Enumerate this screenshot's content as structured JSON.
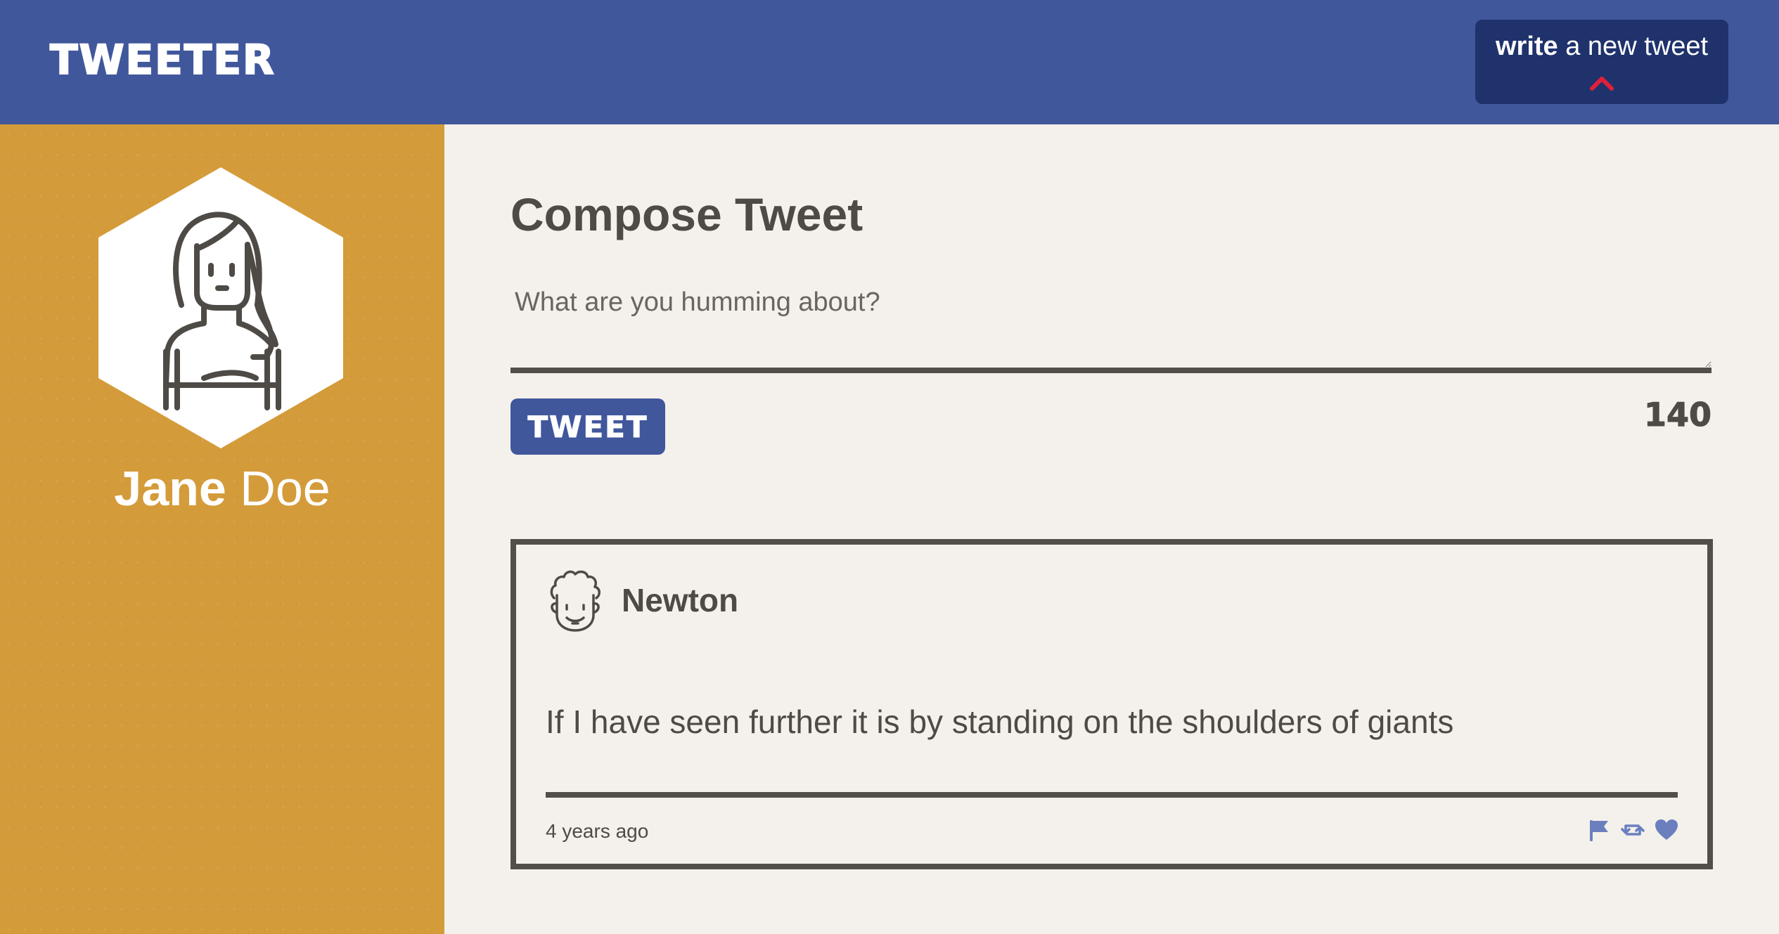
{
  "nav": {
    "brand": "TWEETER",
    "write_bold": "write",
    "write_rest": " a new tweet",
    "chevron_color": "#e0203a"
  },
  "sidebar": {
    "first_name": "Jane",
    "last_name": "Doe",
    "avatar_icon": "woman-avatar-icon"
  },
  "compose": {
    "title": "Compose Tweet",
    "placeholder": "What are you humming about?",
    "button_label": "TWEET",
    "counter": "140"
  },
  "tweet": {
    "author": "Newton",
    "avatar_icon": "man-avatar-icon",
    "body": "If I have seen further it is by standing on the shoulders of giants",
    "time": "4 years ago",
    "actions": [
      "flag-icon",
      "retweet-icon",
      "heart-icon"
    ]
  },
  "colors": {
    "nav_bg": "#40579c",
    "write_button_bg": "#1f326b",
    "sidebar_bg": "#d49b3a",
    "main_bg": "#f4f1ec",
    "text": "#4e4a46",
    "icon_blue": "#6b7fbf"
  }
}
